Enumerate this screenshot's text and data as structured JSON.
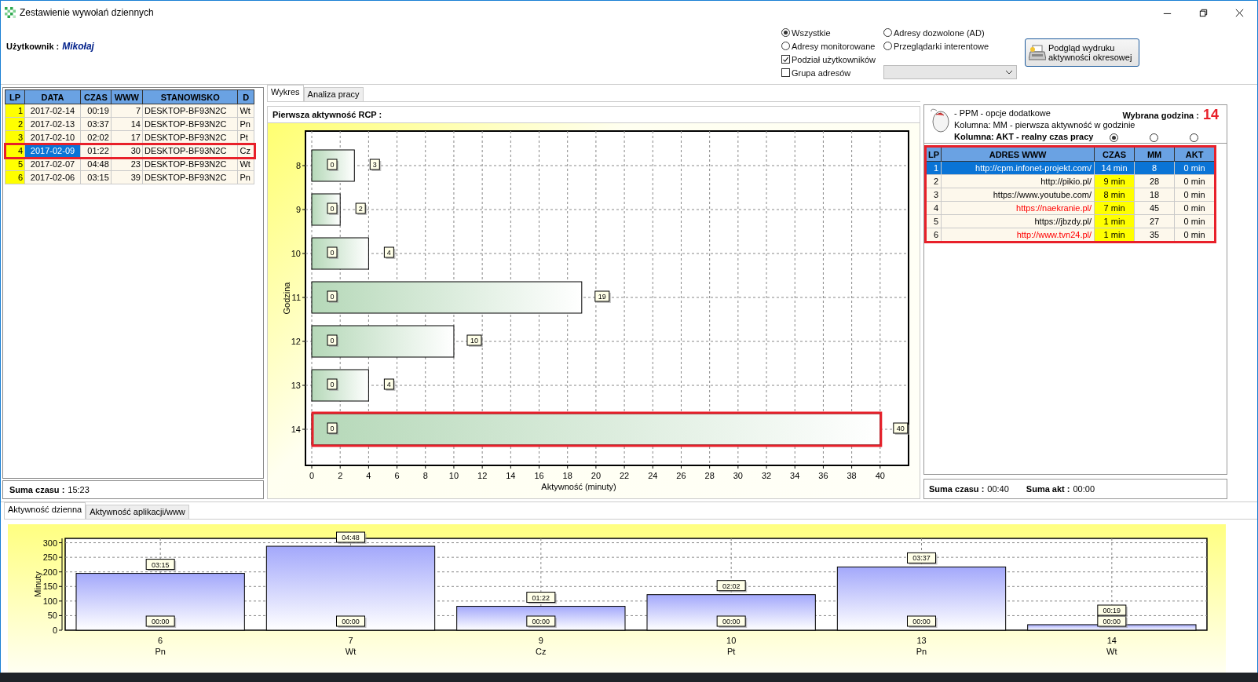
{
  "window": {
    "title": "Zestawienie wywołań dziennych"
  },
  "user": {
    "label": "Użytkownik :",
    "name": "Mikołaj"
  },
  "filters": {
    "radios": [
      {
        "label": "Wszystkie",
        "selected": true
      },
      {
        "label": "Adresy monitorowane",
        "selected": false
      },
      {
        "label": "Adresy dozwolone (AD)",
        "selected": false
      },
      {
        "label": "Przeglądarki interentowe",
        "selected": false
      }
    ],
    "checkboxes": [
      {
        "label": "Podział użytkowników",
        "checked": true
      },
      {
        "label": "Grupa adresów",
        "checked": false
      }
    ],
    "group_dropdown": {
      "disabled": true
    },
    "print_button": {
      "label": "Podgląd wydruku\naktywności okresowej"
    }
  },
  "dates_table": {
    "columns": [
      "LP",
      "DATA",
      "CZAS",
      "WWW",
      "STANOWISKO",
      "D"
    ],
    "rows": [
      {
        "cells": [
          "1",
          "2017-02-14",
          "00:19",
          "7",
          "DESKTOP-BF93N2C",
          "Wt"
        ],
        "selected": false
      },
      {
        "cells": [
          "2",
          "2017-02-13",
          "03:37",
          "14",
          "DESKTOP-BF93N2C",
          "Pn"
        ],
        "selected": false
      },
      {
        "cells": [
          "3",
          "2017-02-10",
          "02:02",
          "17",
          "DESKTOP-BF93N2C",
          "Pt"
        ],
        "selected": false
      },
      {
        "cells": [
          "4",
          "2017-02-09",
          "01:22",
          "30",
          "DESKTOP-BF93N2C",
          "Cz"
        ],
        "selected": true
      },
      {
        "cells": [
          "5",
          "2017-02-07",
          "04:48",
          "23",
          "DESKTOP-BF93N2C",
          "Wt"
        ],
        "selected": false
      },
      {
        "cells": [
          "6",
          "2017-02-06",
          "03:15",
          "39",
          "DESKTOP-BF93N2C",
          "Pn"
        ],
        "selected": false
      }
    ],
    "footer": {
      "label": "Suma czasu :",
      "value": "15:23"
    }
  },
  "chart_tabs": [
    {
      "label": "Wykres",
      "selected": true
    },
    {
      "label": "Analiza pracy",
      "selected": false
    }
  ],
  "chart_panel": {
    "title": "Pierwsza aktywność RCP :",
    "bars": [
      {
        "highlighted": false
      },
      {
        "highlighted": false
      },
      {
        "highlighted": false
      },
      {
        "highlighted": false
      },
      {
        "highlighted": false
      },
      {
        "highlighted": false
      },
      {
        "highlighted": true
      }
    ],
    "chart_data": {
      "type": "bar",
      "orientation": "horizontal",
      "xlabel": "Aktywność (minuty)",
      "ylabel": "Godzina",
      "categories": [
        "8",
        "9",
        "10",
        "11",
        "12",
        "13",
        "14"
      ],
      "series": [
        {
          "values": [
            0,
            0,
            0,
            0,
            0,
            0,
            0
          ]
        },
        {
          "values": [
            3,
            2,
            4,
            19,
            10,
            4,
            40
          ]
        }
      ],
      "xlim": [
        0,
        42
      ],
      "xticks": [
        0,
        2,
        4,
        6,
        8,
        10,
        12,
        14,
        16,
        18,
        20,
        22,
        24,
        26,
        28,
        30,
        32,
        34,
        36,
        38,
        40
      ],
      "grid": true,
      "value_labels": [
        [
          "0",
          "0",
          "0",
          "0",
          "0",
          "0",
          "0"
        ],
        [
          "3",
          "2",
          "4",
          "19",
          "10",
          "4",
          "40"
        ]
      ]
    }
  },
  "hour_info": {
    "lines": [
      {
        "text": "- PPM - opcje dodatkowe",
        "bold": false
      },
      {
        "text": "Kolumna: MM - pierwsza aktywność w godzinie",
        "bold": false
      },
      {
        "text": "Kolumna: AKT - realny czas pracy",
        "bold": true
      }
    ],
    "selected_hour": {
      "label": "Wybrana godzina :",
      "value": "14"
    },
    "column_radios": [
      {
        "selected": true
      },
      {
        "selected": false
      },
      {
        "selected": false
      }
    ]
  },
  "url_table": {
    "columns": [
      "LP",
      "ADRES WWW",
      "CZAS",
      "MM",
      "AKT"
    ],
    "rows": [
      {
        "cells": [
          "1",
          "http://cpm.infonet-projekt.com/",
          "14 min",
          "8",
          "0 min"
        ],
        "flagged": false,
        "selected": true
      },
      {
        "cells": [
          "2",
          "http://pikio.pl/",
          "9 min",
          "28",
          "0 min"
        ],
        "flagged": false,
        "selected": false
      },
      {
        "cells": [
          "3",
          "https://www.youtube.com/",
          "8 min",
          "18",
          "0 min"
        ],
        "flagged": false,
        "selected": false
      },
      {
        "cells": [
          "4",
          "https://naekranie.pl/",
          "7 min",
          "45",
          "0 min"
        ],
        "flagged": true,
        "selected": false
      },
      {
        "cells": [
          "5",
          "https://jbzdy.pl/",
          "1 min",
          "27",
          "0 min"
        ],
        "flagged": false,
        "selected": false
      },
      {
        "cells": [
          "6",
          "http://www.tvn24.pl/",
          "1 min",
          "35",
          "0 min"
        ],
        "flagged": true,
        "selected": false
      }
    ],
    "footer": [
      {
        "label": "Suma czasu :",
        "value": "00:40"
      },
      {
        "label": "Suma akt :",
        "value": "00:00"
      }
    ]
  },
  "bottom_tabs": [
    {
      "label": "Aktywność dzienna",
      "selected": true
    },
    {
      "label": "Aktywność aplikacji/www",
      "selected": false
    }
  ],
  "daily_chart": {
    "day_names": [
      "Pn",
      "Wt",
      "Cz",
      "Pt",
      "Pn",
      "Wt"
    ],
    "chart_data": {
      "type": "bar",
      "orientation": "vertical",
      "ylabel": "Minuty",
      "categories": [
        "6",
        "7",
        "9",
        "10",
        "13",
        "14"
      ],
      "series": [
        {
          "values": [
            0,
            0,
            0,
            0,
            0,
            0
          ]
        },
        {
          "values": [
            195,
            288,
            82,
            122,
            217,
            19
          ]
        }
      ],
      "ylim": [
        0,
        315
      ],
      "yticks": [
        0,
        50,
        100,
        150,
        200,
        250,
        300
      ],
      "grid": true,
      "value_labels": [
        [
          "00:00",
          "00:00",
          "00:00",
          "00:00",
          "00:00",
          "00:00"
        ],
        [
          "03:15",
          "04:48",
          "01:22",
          "02:02",
          "03:37",
          "00:19"
        ]
      ]
    }
  }
}
